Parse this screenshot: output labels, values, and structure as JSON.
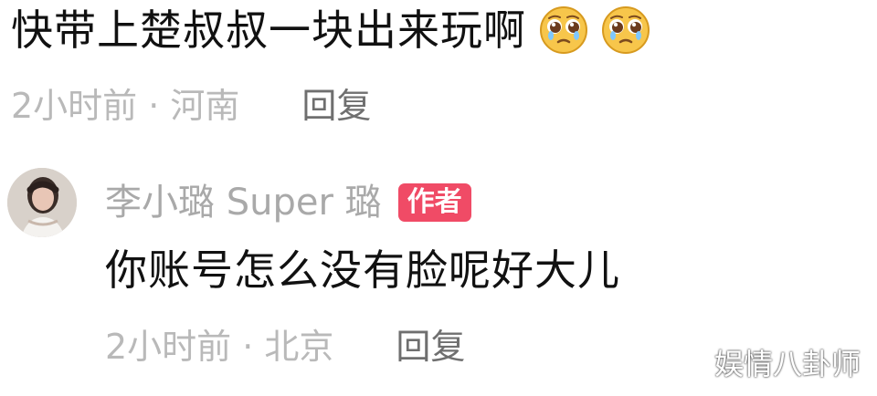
{
  "comment": {
    "text": "快带上楚叔叔一块出来玩啊",
    "emojis": [
      "pleading-face-emoji",
      "pleading-face-emoji"
    ],
    "time": "2小时前 · 河南",
    "reply_label": "回复"
  },
  "reply": {
    "avatar": "user-avatar",
    "author_name": "李小璐 Super 璐",
    "author_badge": "作者",
    "text": "你账号怎么没有脸呢好大儿",
    "time": "2小时前 · 北京",
    "reply_label": "回复"
  },
  "watermark": {
    "text": "娱情八卦师"
  },
  "colors": {
    "primary_text": "#111111",
    "meta_text": "#b9b9b9",
    "reply_button": "#6f6f6f",
    "author_name": "#a9a9a9",
    "author_badge": "#f04b66",
    "background": "#ffffff"
  }
}
